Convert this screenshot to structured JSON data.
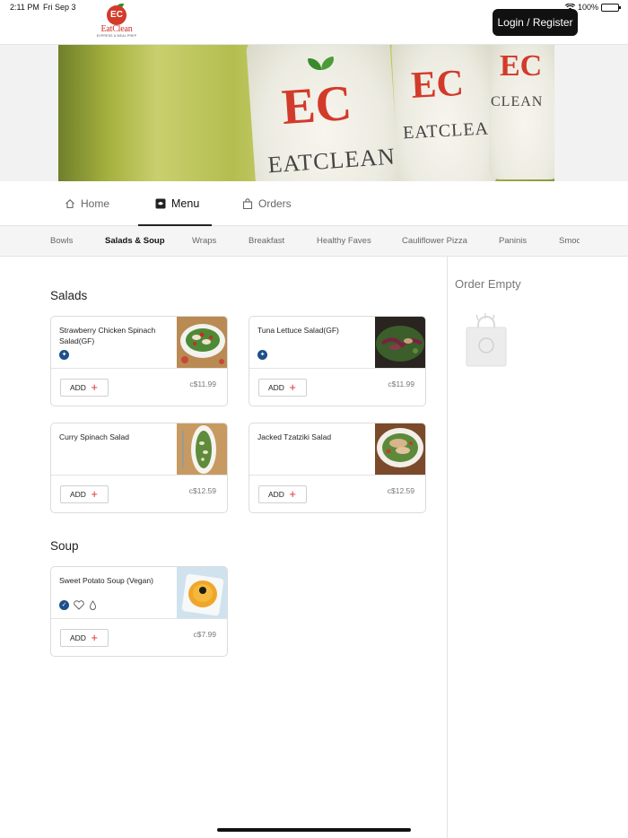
{
  "status": {
    "time": "2:11 PM",
    "date": "Fri Sep 3",
    "battery": "100%"
  },
  "brand": {
    "monogram": "EC",
    "name": "EatClean",
    "tagline": "EXPRESS & MEAL PREP"
  },
  "header": {
    "login_label": "Login / Register"
  },
  "nav": {
    "items": [
      {
        "label": "Home",
        "icon": "home-icon"
      },
      {
        "label": "Menu",
        "icon": "menu-book-icon"
      },
      {
        "label": "Orders",
        "icon": "bag-icon"
      }
    ],
    "active": "Menu"
  },
  "categories": {
    "items": [
      "Bowls",
      "Salads & Soup",
      "Wraps",
      "Breakfast",
      "Healthy Faves",
      "Cauliflower Pizza",
      "Paninis",
      "Smoo"
    ],
    "active": "Salads & Soup"
  },
  "sections": [
    {
      "title": "Salads",
      "items": [
        {
          "name": "Strawberry Chicken Spinach Salad(GF)",
          "price": "c$11.99",
          "add_label": "ADD",
          "badges": [
            "gluten-free-icon"
          ]
        },
        {
          "name": "Tuna Lettuce Salad(GF)",
          "price": "c$11.99",
          "add_label": "ADD",
          "badges": [
            "gluten-free-icon"
          ]
        },
        {
          "name": "Curry Spinach Salad",
          "price": "c$12.59",
          "add_label": "ADD",
          "badges": []
        },
        {
          "name": "Jacked Tzatziki Salad",
          "price": "c$12.59",
          "add_label": "ADD",
          "badges": []
        }
      ]
    },
    {
      "title": "Soup",
      "items": [
        {
          "name": "Sweet Potato Soup (Vegan)",
          "price": "c$7.99",
          "add_label": "ADD",
          "badges": [
            "vegan-check-icon",
            "heart-icon",
            "drop-icon"
          ]
        }
      ]
    }
  ],
  "order": {
    "title": "Order Empty",
    "icon": "shopping-bag-icon"
  },
  "colors": {
    "accent": "#d33333",
    "badge": "#1d4f8c",
    "button_dark": "#111111"
  }
}
